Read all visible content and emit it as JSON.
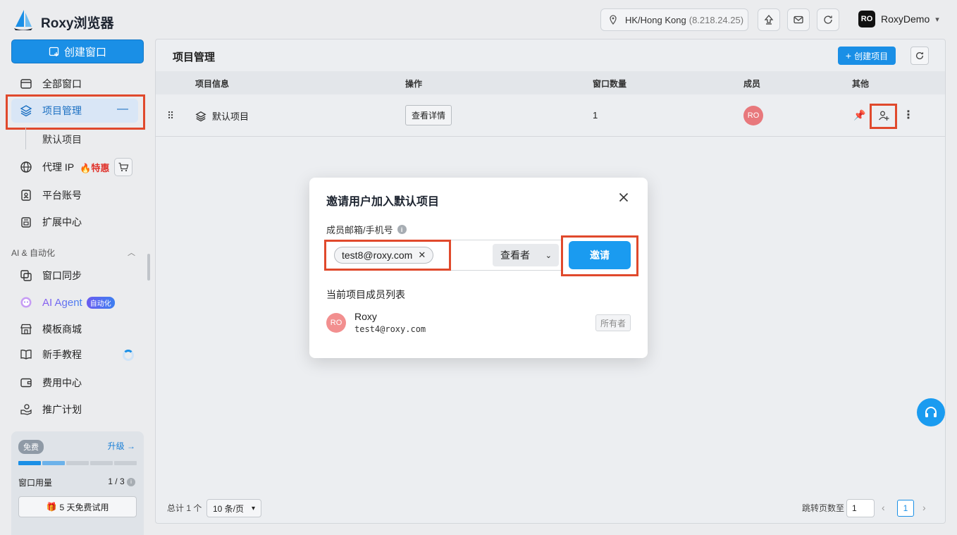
{
  "app": {
    "title": "Roxy浏览器"
  },
  "topbar": {
    "location": "HK/Hong Kong",
    "ip": "(8.218.24.25)",
    "user_initials": "RO",
    "user_name": "RoxyDemo"
  },
  "sidebar": {
    "create_window": "创建窗口",
    "items": [
      {
        "label": "全部窗口",
        "icon": "window-icon"
      },
      {
        "label": "项目管理",
        "icon": "layers-icon"
      },
      {
        "label": "代理 IP",
        "icon": "globe-icon"
      },
      {
        "label": "平台账号",
        "icon": "account-icon"
      },
      {
        "label": "扩展中心",
        "icon": "extension-icon"
      }
    ],
    "sub_item": "默认项目",
    "hot_label": "特惠",
    "section_title": "AI & 自动化",
    "ai_items": [
      {
        "label": "窗口同步",
        "icon": "sync-window-icon"
      },
      {
        "label": "AI Agent",
        "icon": "ai-agent-icon",
        "badge": "自动化"
      },
      {
        "label": "模板商城",
        "icon": "store-icon"
      },
      {
        "label": "新手教程",
        "icon": "book-icon"
      },
      {
        "label": "费用中心",
        "icon": "wallet-icon"
      },
      {
        "label": "推广计划",
        "icon": "promote-icon"
      }
    ],
    "plan": {
      "tier": "免费",
      "upgrade": "升级 →",
      "usage_label": "窗口用量",
      "usage_count": "1 / 3",
      "usage_fraction": 0.333,
      "trial": "5 天免费试用"
    }
  },
  "main": {
    "title": "项目管理",
    "new_project": "创建项目",
    "columns": [
      "项目信息",
      "操作",
      "窗口数量",
      "成员",
      "其他"
    ],
    "row": {
      "name": "默认项目",
      "action": "查看详情",
      "window_count": "1",
      "member_initials": "RO"
    },
    "footer": {
      "total": "总计 1 个",
      "page_size": "10 条/页",
      "jump_label": "跳转页数至",
      "jump_value": "1",
      "current_page": "1"
    }
  },
  "modal": {
    "title": "邀请用户加入默认项目",
    "field_label": "成员邮箱/手机号",
    "tag_value": "test8@roxy.com",
    "role": "查看者",
    "invite": "邀请",
    "list_title": "当前项目成员列表",
    "member": {
      "initials": "RO",
      "name": "Roxy",
      "email": "test4@roxy.com",
      "role": "所有者"
    }
  },
  "colors": {
    "accent": "#1a8fe6",
    "highlight": "#e0492c",
    "avatar": "#e8787c"
  }
}
